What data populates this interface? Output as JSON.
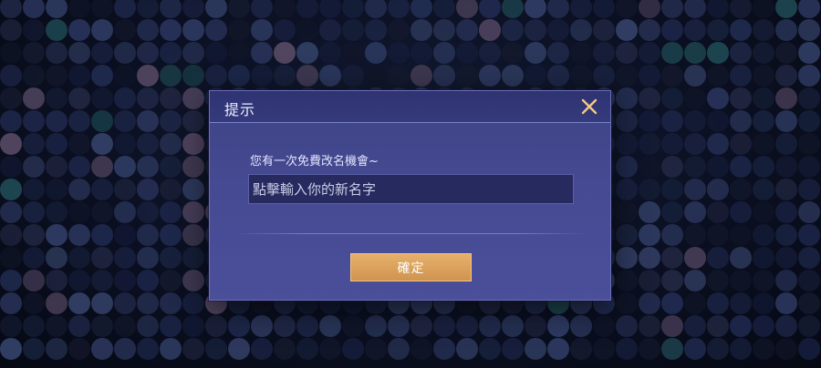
{
  "dialog": {
    "title": "提示",
    "close_icon": "close-x-icon",
    "message": "您有一次免費改名機會~",
    "name_input": {
      "value": "",
      "placeholder": "點擊輸入你的新名字"
    },
    "confirm_label": "確定"
  },
  "colors": {
    "dialog_bg": "#454a92",
    "header_bg": "#333878",
    "input_bg": "#272a5e",
    "confirm_button": "#dca060",
    "close_icon": "#f2c88a"
  }
}
